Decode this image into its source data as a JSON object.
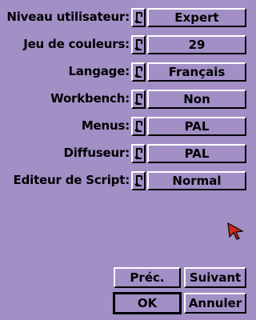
{
  "settings": [
    {
      "label": "Niveau utilisateur:",
      "value": "Expert"
    },
    {
      "label": "Jeu de couleurs:",
      "value": "29"
    },
    {
      "label": "Langage:",
      "value": "Français"
    },
    {
      "label": "Workbench:",
      "value": "Non"
    },
    {
      "label": "Menus:",
      "value": "PAL"
    },
    {
      "label": "Diffuseur:",
      "value": "PAL"
    },
    {
      "label": "Editeur de Script:",
      "value": "Normal"
    }
  ],
  "buttons": {
    "prev": "Préc.",
    "next": "Suivant",
    "ok": "OK",
    "cancel": "Annuler"
  },
  "colors": {
    "background": "#a18fc6",
    "pointer": "#cc2a1d"
  },
  "icons": {
    "cycle": "cycle-gadget-icon",
    "pointer": "mouse-pointer-icon"
  }
}
